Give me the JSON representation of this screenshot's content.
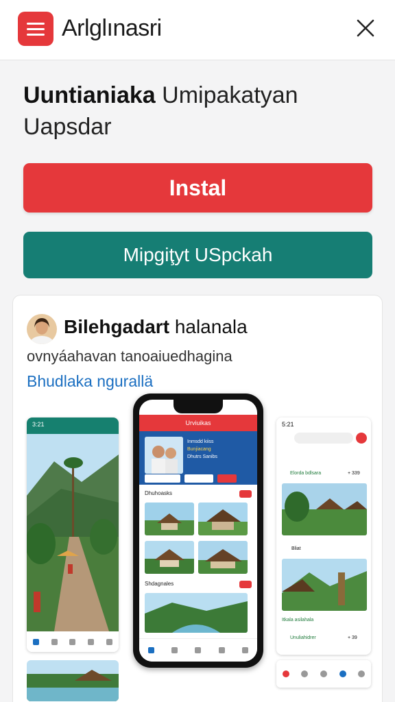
{
  "header": {
    "title": "Arlglınasri",
    "menu_icon": "hamburger-menu-icon",
    "close_icon": "close-icon",
    "accent_color": "#e5383b"
  },
  "main": {
    "headline_bold": "Uuntianiaka",
    "headline_rest": "Umipakatyan Uapsdar",
    "install_label": "Instal",
    "secondary_label": "Mipgiţyt USpckah",
    "install_color": "#e5383b",
    "secondary_color": "#167e74"
  },
  "developer_card": {
    "name_bold": "Bilehgadart",
    "name_rest": "halanala",
    "description": "ovnyáahavan tanoaiuedhagina",
    "link_text": "Bhudlaka ngurallä",
    "link_color": "#1b6fc1"
  },
  "screenshots": {
    "left": {
      "status": "3:21"
    },
    "center": {
      "header_title": "Urviuikas",
      "hero_line1": "Inmsdd kiiss",
      "hero_line2": "Bunjiacang",
      "hero_line3": "Dhutrs Sanibs",
      "section1": "Dhuhoasks",
      "section2": "Shdagnales"
    },
    "right": {
      "status": "5:21",
      "row1": "Elorda bdlsara",
      "row1_price": "+ 339",
      "row2": "Bliat",
      "row3": "Itkala asilahala",
      "row4": "Unuliahidrer",
      "row4_price": "+ 39"
    }
  }
}
